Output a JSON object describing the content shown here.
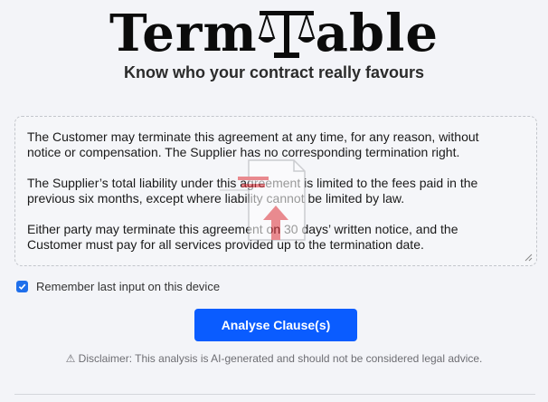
{
  "app": {
    "logo_left": "Term",
    "logo_right": "able",
    "tagline": "Know who your contract really favours"
  },
  "clauses": [
    "The Customer may terminate this agreement at any time, for any reason, without notice or compensation. The Supplier has no corresponding termination right.",
    "The Supplier’s total liability under this agreement is limited to the fees paid in the previous six months, except where liability cannot be limited by law.",
    "Either party may terminate this agreement on 30 days’ written notice, and the Customer must pay for all services provided up to the termination date."
  ],
  "remember": {
    "label": "Remember last input on this device",
    "checked": true
  },
  "analyse_button": "Analyse Clause(s)",
  "disclaimer": "⚠ Disclaimer: This analysis is AI-generated and should not be considered legal advice.",
  "icons": {
    "logo": "scales-icon",
    "upload": "upload-file-icon",
    "checkbox": "check-icon",
    "resize": "resize-grip-icon"
  },
  "colors": {
    "accent": "#0a5cff",
    "upload_icon": "#e0323a"
  }
}
